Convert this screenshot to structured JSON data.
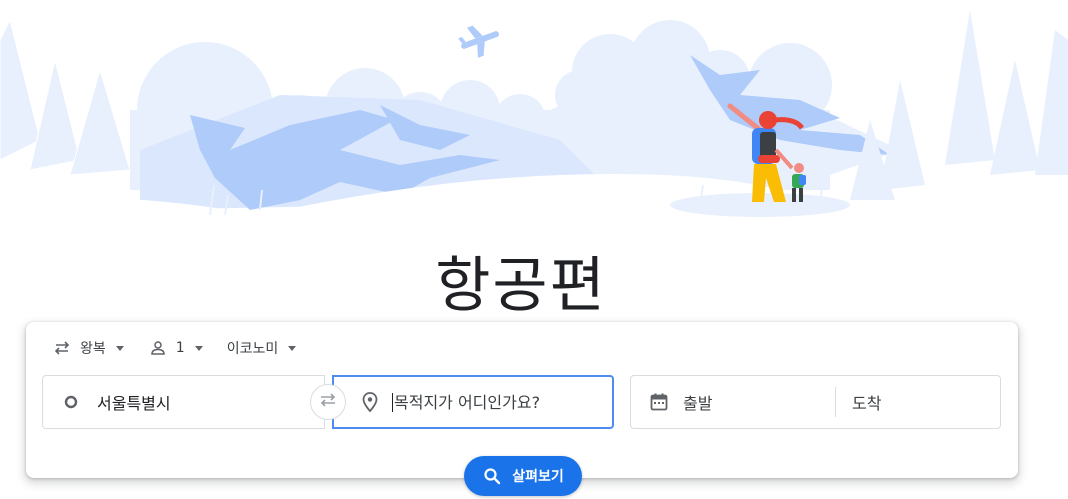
{
  "hero": {
    "title": "항공편"
  },
  "search": {
    "trip_type": {
      "label": "왕복",
      "icon": "swap-arrows-icon"
    },
    "passengers": {
      "label": "1",
      "icon": "person-icon"
    },
    "cabin_class": {
      "label": "이코노미"
    },
    "origin": {
      "value": "서울특별시",
      "icon": "circle-icon"
    },
    "destination": {
      "placeholder": "목적지가 어디인가요?",
      "icon": "location-pin-icon"
    },
    "swap_icon": "swap-horizontal-icon",
    "dates": {
      "icon": "calendar-icon",
      "departure_placeholder": "출발",
      "return_placeholder": "도착"
    },
    "explore_button": {
      "label": "살펴보기",
      "icon": "search-icon"
    }
  },
  "colors": {
    "accent": "#1a73e8",
    "focus_border": "#4e8cf0",
    "illustration_blue": "#aecbfa",
    "illustration_light": "#e8f0fe"
  }
}
